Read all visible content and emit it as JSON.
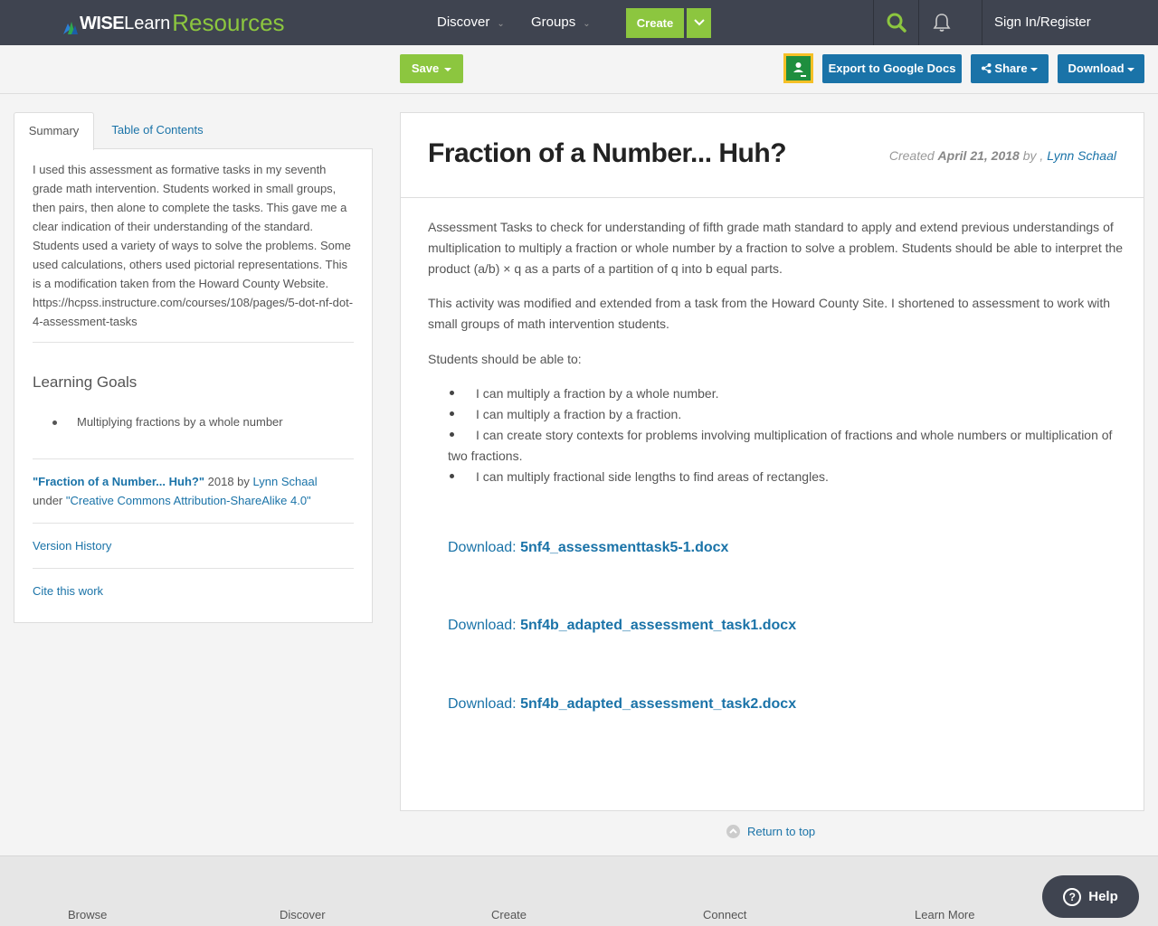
{
  "header": {
    "logo_wise": "WISE",
    "logo_learn": "Learn",
    "logo_resources": "Resources",
    "nav": [
      {
        "label": "Discover"
      },
      {
        "label": "Groups"
      }
    ],
    "create_label": "Create",
    "signin_label": "Sign In/Register"
  },
  "toolbar": {
    "save_label": "Save",
    "export_label": "Export to Google Docs",
    "share_label": "Share",
    "download_label": "Download"
  },
  "sidebar": {
    "tabs": [
      {
        "label": "Summary"
      },
      {
        "label": "Table of Contents"
      }
    ],
    "summary_text": "I used this assessment as formative tasks in my seventh grade math intervention. Students worked in small groups, then pairs, then alone to complete the tasks. This gave me a clear indication of their understanding of the standard. Students used a variety of ways to solve the problems. Some used calculations, others used pictorial representations. This is a modification taken from the Howard County Website. https://hcpss.instructure.com/courses/108/pages/5-dot-nf-dot-4-assessment-tasks",
    "learning_goals_title": "Learning Goals",
    "learning_goals": [
      "Multiplying fractions by a whole number"
    ],
    "attribution": {
      "work_title": "\"Fraction of a Number... Huh?\"",
      "year_by": "2018 by",
      "author": "Lynn Schaal",
      "under": "under",
      "license": "\"Creative Commons Attribution-ShareAlike 4.0\""
    },
    "version_history": "Version History",
    "cite": "Cite this work"
  },
  "main": {
    "title": "Fraction of a Number... Huh?",
    "created_label": "Created",
    "created_date": "April 21, 2018",
    "by_label": "by ,",
    "author": "Lynn Schaal",
    "paragraphs": [
      "Assessment Tasks to check for understanding of fifth grade math standard to apply and extend previous understandings of multiplication to multiply a fraction or whole number by a fraction to solve a problem.  Students should be able to interpret the product (a/b) × q as a parts of a partition of q into b equal parts.",
      "This activity was modified and extended from a task from the Howard County Site.  I shortened to assessment to work with small groups of math intervention students.",
      "Students should be able to:"
    ],
    "goals": [
      "I can multiply a fraction by a whole number.",
      "I can multiply a fraction by a fraction.",
      "I can create story contexts for problems involving multiplication of fractions and whole numbers or multiplication of two fractions.",
      "I can multiply fractional side lengths to find areas of rectangles."
    ],
    "downloads": [
      {
        "prefix": "Download:",
        "file": "5nf4_assessmenttask5-1.docx"
      },
      {
        "prefix": "Download:",
        "file": "5nf4b_adapted_assessment_task1.docx"
      },
      {
        "prefix": "Download:",
        "file": "5nf4b_adapted_assessment_task2.docx"
      }
    ],
    "return_top": "Return to top"
  },
  "footer": {
    "columns": [
      "Browse",
      "Discover",
      "Create",
      "Connect",
      "Learn More"
    ],
    "help_label": "Help"
  },
  "colors": {
    "nav_bg": "#3f4450",
    "accent_green": "#8cc63f",
    "link_blue": "#1a73a8"
  }
}
